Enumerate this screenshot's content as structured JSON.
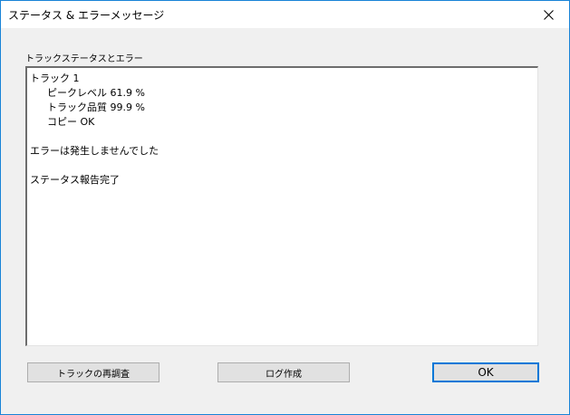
{
  "window": {
    "title": "ステータス & エラーメッセージ",
    "close_label": "×"
  },
  "group": {
    "label": "トラックステータスとエラー"
  },
  "status": {
    "lines": [
      "トラック  1",
      "ピークレベル  61.9 %",
      "トラック品質  99.9 %",
      "コピー OK",
      "",
      "エラーは発生しませんでした",
      "",
      "ステータス報告完了"
    ]
  },
  "buttons": {
    "retest": "トラックの再調査",
    "create_log": "ログ作成",
    "ok": "OK"
  },
  "colors": {
    "accent": "#0078d7",
    "window_border": "#1883d7",
    "face": "#f0f0f0",
    "button_face": "#e1e1e1"
  }
}
